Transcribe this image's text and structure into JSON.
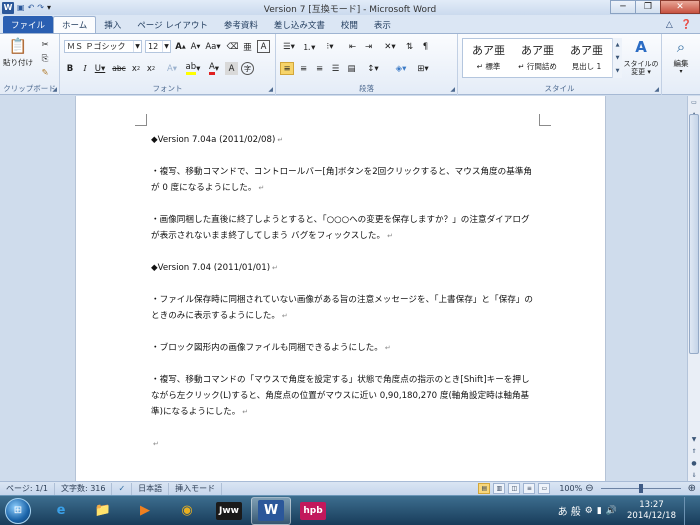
{
  "window": {
    "title": "Version 7 [互換モード] - Microsoft Word",
    "qat_icons": [
      "word-icon",
      "save-icon",
      "undo-icon",
      "redo-icon",
      "customize-qat-icon"
    ]
  },
  "tabs": [
    {
      "label": "ファイル",
      "name": "tab-file"
    },
    {
      "label": "ホーム",
      "name": "tab-home"
    },
    {
      "label": "挿入",
      "name": "tab-insert"
    },
    {
      "label": "ページ レイアウト",
      "name": "tab-page-layout"
    },
    {
      "label": "参考資料",
      "name": "tab-references"
    },
    {
      "label": "差し込み文書",
      "name": "tab-mailings"
    },
    {
      "label": "校閲",
      "name": "tab-review"
    },
    {
      "label": "表示",
      "name": "tab-view"
    }
  ],
  "ribbon": {
    "clipboard": {
      "label": "クリップボード",
      "paste_label": "貼り付け"
    },
    "font": {
      "label": "フォント",
      "font_name": "ＭＳ Ｐゴシック",
      "font_size": "12"
    },
    "paragraph": {
      "label": "段落"
    },
    "styles": {
      "label": "スタイル",
      "items": [
        {
          "preview": "あア亜",
          "name": "↵ 標準"
        },
        {
          "preview": "あア亜",
          "name": "↵ 行間詰め"
        },
        {
          "preview": "あア亜",
          "name": "見出し 1"
        }
      ],
      "change_styles_label": "スタイルの\n変更 ▾"
    },
    "editing": {
      "label": "編集"
    }
  },
  "document": {
    "paragraphs": [
      "◆Version 7.04a (2011/02/08)",
      "",
      "・複写、移動コマンドで、コントロールバー[角]ボタンを2回クリックすると、マウス角度の基準角が 0 度になるようにした。",
      "",
      "・画像同梱した直後に終了しようとすると、「○○○への変更を保存しますか？」の注意ダイアログが表示されないまま終了してしまう バグをフィックスした。",
      "",
      "◆Version 7.04 (2011/01/01)",
      "",
      "・ファイル保存時に同梱されていない画像がある旨の注意メッセージを、「上書保存」と「保存」のときのみに表示するようにした。",
      "",
      "・ブロック図形内の画像ファイルも同梱できるようにした。",
      "",
      "・複写、移動コマンドの「マウスで角度を設定する」状態で角度点の指示のとき[Shift]キーを押しながら左クリック(L)すると、角度点の位置がマウスに近い 0,90,180,270 度(軸角設定時は軸角基準)になるようにした。",
      "",
      ""
    ],
    "paragraph_mark": "↵"
  },
  "statusbar": {
    "page": "ページ: 1/1",
    "words": "文字数: 316",
    "language": "日本語",
    "mode": "挿入モード",
    "zoom": "100%",
    "zoom_level": 1.0
  },
  "taskbar": {
    "apps": [
      {
        "name": "ie-icon",
        "glyph": "e",
        "color": "#3aa0e8"
      },
      {
        "name": "explorer-icon",
        "glyph": "📁",
        "color": "#f0c040"
      },
      {
        "name": "media-player-icon",
        "glyph": "▶",
        "color": "#f08020"
      },
      {
        "name": "chrome-icon",
        "glyph": "◉",
        "color": "#e8b020"
      },
      {
        "name": "jww-icon",
        "glyph": "Jww",
        "color": "#ffffff"
      },
      {
        "name": "word-taskbar-icon",
        "glyph": "W",
        "color": "#ffffff"
      },
      {
        "name": "hpb-icon",
        "glyph": "hpb",
        "color": "#ffffff"
      }
    ],
    "ime": "あ 般",
    "clock_time": "13:27",
    "clock_date": "2014/12/18"
  }
}
